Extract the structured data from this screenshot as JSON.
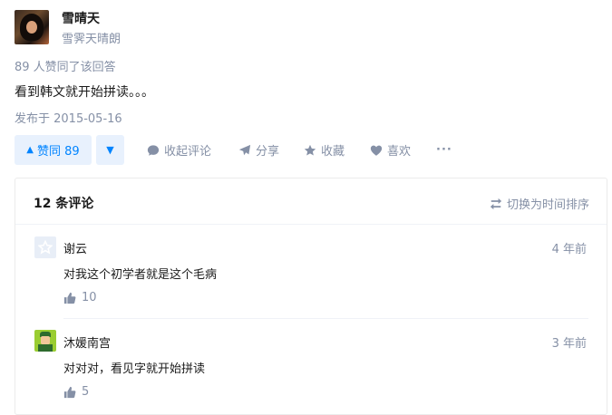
{
  "author": {
    "name": "雪晴天",
    "bio": "雪霁天晴朗"
  },
  "answer": {
    "voters_text": "89 人赞同了该回答",
    "content": "看到韩文就开始拼读。。。",
    "published": "发布于 2015-05-16"
  },
  "actions": {
    "vote_label": "赞同 89",
    "collapse_comments": "收起评论",
    "share": "分享",
    "favorite": "收藏",
    "like": "喜欢",
    "more": "···"
  },
  "comments": {
    "count_label": "12 条评论",
    "sort_label": "切换为时间排序",
    "items": [
      {
        "name": "谢云",
        "time": "4 年前",
        "text": "对我这个初学者就是这个毛病",
        "likes": "10"
      },
      {
        "name": "沐媛南宫",
        "time": "3 年前",
        "text": "对对对，看见字就开始拼读",
        "likes": "5"
      }
    ]
  },
  "colors": {
    "accent": "#0084ff",
    "accent_bg": "#e8f1fd",
    "muted": "#8590a6"
  }
}
